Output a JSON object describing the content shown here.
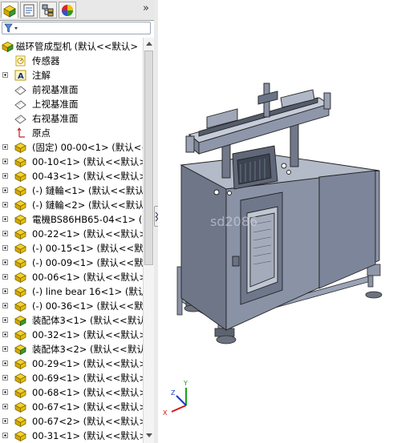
{
  "tabs": [
    {
      "name": "featuremanager-tab",
      "icon": "featuremanager-icon",
      "active": true
    },
    {
      "name": "propertymanager-tab",
      "icon": "propertymanager-icon",
      "active": false
    },
    {
      "name": "configurationmanager-tab",
      "icon": "configurationmanager-icon",
      "active": false
    },
    {
      "name": "displaymanager-tab",
      "icon": "displaymanager-icon",
      "active": false
    }
  ],
  "tab_overflow": "»",
  "filter": {
    "icon": "filter-icon",
    "value": ""
  },
  "tree": {
    "root": {
      "label": "磁环管成型机  (默认<<默认>",
      "icon": "assembly-icon"
    },
    "items": [
      {
        "label": "传感器",
        "icon": "sensor-icon",
        "expander": false
      },
      {
        "label": "注解",
        "icon": "annotation-icon",
        "expander": true
      },
      {
        "label": "前视基准面",
        "icon": "plane-icon",
        "expander": false
      },
      {
        "label": "上视基准面",
        "icon": "plane-icon",
        "expander": false
      },
      {
        "label": "右视基准面",
        "icon": "plane-icon",
        "expander": false
      },
      {
        "label": "原点",
        "icon": "origin-icon",
        "expander": false
      },
      {
        "label": "(固定) 00-00<1> (默认<<默",
        "icon": "part-icon",
        "expander": true
      },
      {
        "label": "00-10<1> (默认<<默认>",
        "icon": "part-icon",
        "expander": true
      },
      {
        "label": "00-43<1> (默认<<默认>",
        "icon": "part-icon",
        "expander": true
      },
      {
        "label": "(-) 鏈輪<1> (默认<<默认",
        "icon": "part-icon",
        "expander": true
      },
      {
        "label": "(-) 鏈輪<2> (默认<<默认",
        "icon": "part-icon",
        "expander": true
      },
      {
        "label": "電機BS86HB65-04<1> (",
        "icon": "part-icon",
        "expander": true
      },
      {
        "label": "00-22<1> (默认<<默认>",
        "icon": "part-icon",
        "expander": true
      },
      {
        "label": "(-) 00-15<1> (默认<<默",
        "icon": "part-icon",
        "expander": true
      },
      {
        "label": "(-) 00-09<1> (默认<<默",
        "icon": "part-icon",
        "expander": true
      },
      {
        "label": "00-06<1> (默认<<默认>",
        "icon": "part-icon",
        "expander": true
      },
      {
        "label": "(-) line bear 16<1> (默认",
        "icon": "part-icon",
        "expander": true
      },
      {
        "label": "(-) 00-36<1> (默认<<默",
        "icon": "part-icon",
        "expander": true
      },
      {
        "label": "装配体3<1> (默认<<默认",
        "icon": "subassembly-icon",
        "expander": true
      },
      {
        "label": "00-32<1> (默认<<默认>",
        "icon": "part-icon",
        "expander": true
      },
      {
        "label": "装配体3<2> (默认<<默认",
        "icon": "subassembly-icon",
        "expander": true
      },
      {
        "label": "00-29<1> (默认<<默认>",
        "icon": "part-icon",
        "expander": true
      },
      {
        "label": "00-69<1> (默认<<默认>",
        "icon": "part-icon",
        "expander": true
      },
      {
        "label": "00-68<1> (默认<<默认>",
        "icon": "part-icon",
        "expander": true
      },
      {
        "label": "00-67<1> (默认<<默认>",
        "icon": "part-icon",
        "expander": true
      },
      {
        "label": "00-67<2> (默认<<默认>",
        "icon": "part-icon",
        "expander": true
      },
      {
        "label": "00-31<1> (默认<<默认>",
        "icon": "part-icon",
        "expander": true
      }
    ]
  },
  "viewport": {
    "model": "machine-3d-model",
    "watermark": "sd2086"
  },
  "triad": {
    "x": "X",
    "y": "Y",
    "z": "Z"
  }
}
